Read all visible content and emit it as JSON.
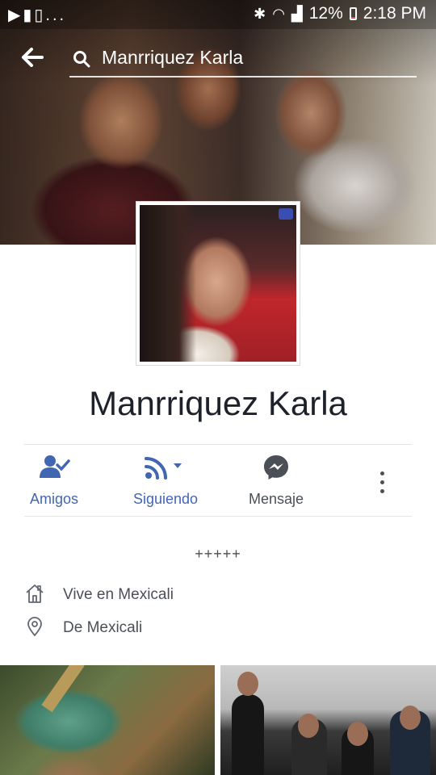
{
  "status_bar": {
    "left_icons": [
      "play-store-icon",
      "alert-icon",
      "clipboard-check-icon",
      "more-notifications-icon"
    ],
    "left_text": "...",
    "battery": "12%",
    "time": "2:18 PM"
  },
  "search": {
    "query": "Manrriquez Karla"
  },
  "profile": {
    "name": "Manrriquez Karla"
  },
  "actions": {
    "friends_label": "Amigos",
    "following_label": "Siguiendo",
    "message_label": "Mensaje",
    "accent_color": "#4267b2",
    "muted_color": "#4b4f56"
  },
  "intro": {
    "text": "+++++"
  },
  "about": {
    "lives_in": "Vive en Mexicali",
    "from": "De Mexicali"
  }
}
